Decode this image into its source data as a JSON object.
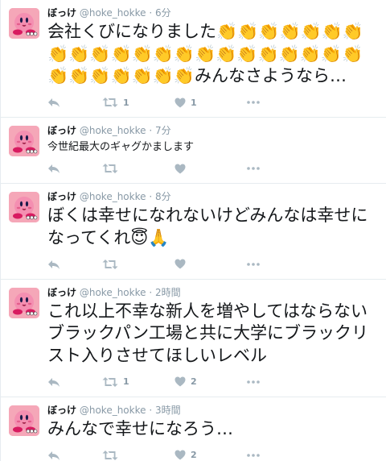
{
  "colors": {
    "accent_grey": "#aab8c2",
    "avatar_pink": "#f7a9b6"
  },
  "tweets": [
    {
      "name": "ぼっけ",
      "handle": "@hoke_hokke",
      "dot": "·",
      "time": "6分",
      "text": "会社くびになりました👏👏👏👏👏👏👏👏👏👏👏👏👏👏👏👏👏👏👏👏👏👏👏👏👏👏👏👏👏みんなさようなら…",
      "size": "big",
      "retweets": "1",
      "likes": "1"
    },
    {
      "name": "ぼっけ",
      "handle": "@hoke_hokke",
      "dot": "·",
      "time": "7分",
      "text": "今世紀最大のギャグかまします",
      "size": "small",
      "retweets": "",
      "likes": ""
    },
    {
      "name": "ぼっけ",
      "handle": "@hoke_hokke",
      "dot": "·",
      "time": "8分",
      "text": "ぼくは幸せになれないけどみんなは幸せになってくれ😇🙏",
      "size": "big",
      "retweets": "",
      "likes": ""
    },
    {
      "name": "ぼっけ",
      "handle": "@hoke_hokke",
      "dot": "·",
      "time": "2時間",
      "text": "これ以上不幸な新人を増やしてはならないブラックパン工場と共に大学にブラックリスト入りさせてほしいレベル",
      "size": "big",
      "retweets": "1",
      "likes": "2"
    },
    {
      "name": "ぼっけ",
      "handle": "@hoke_hokke",
      "dot": "·",
      "time": "3時間",
      "text": "みんなで幸せになろう…",
      "size": "big",
      "retweets": "",
      "likes": "2"
    }
  ],
  "icons": {
    "reply": "reply-icon",
    "retweet": "retweet-icon",
    "like": "heart-icon",
    "more": "more-icon",
    "avatar": "kirby-avatar"
  }
}
